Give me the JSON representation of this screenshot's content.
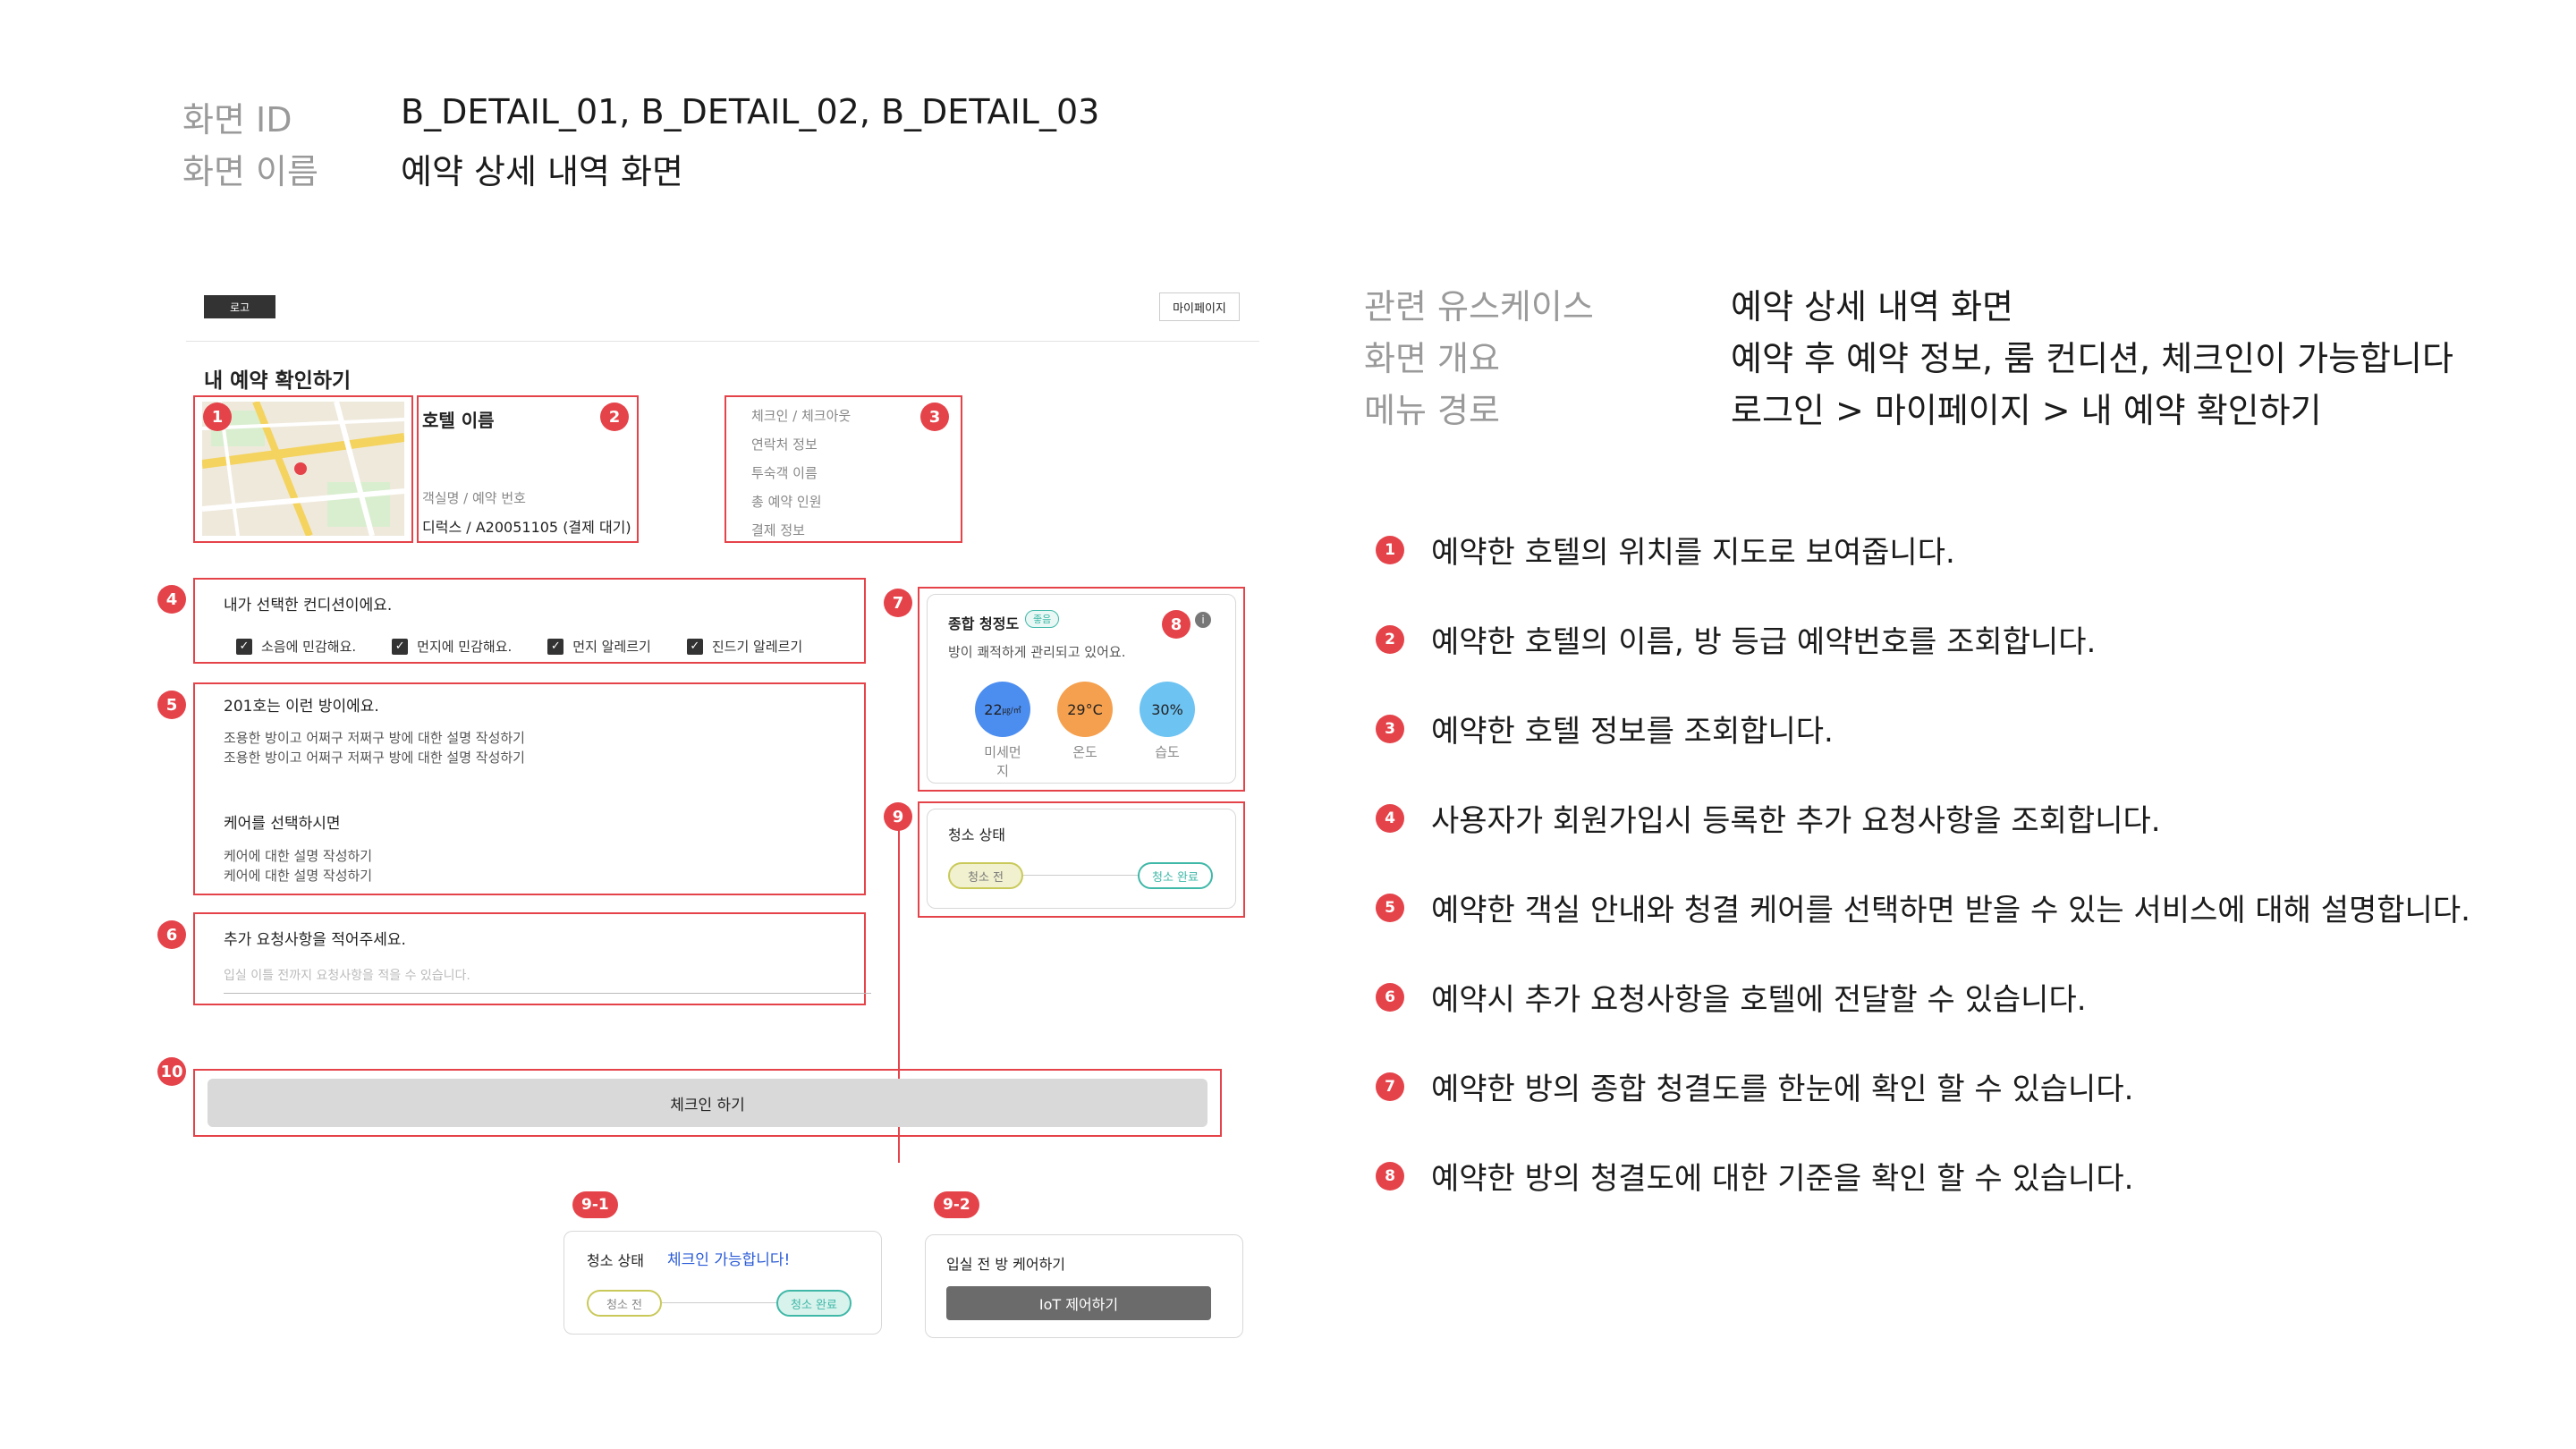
{
  "header": {
    "screen_id_label": "화면 ID",
    "screen_id_value": "B_DETAIL_01, B_DETAIL_02, B_DETAIL_03",
    "screen_name_label": "화면 이름",
    "screen_name_value": "예약 상세 내역 화면"
  },
  "meta": {
    "usecase_label": "관련 유스케이스",
    "usecase_value": "예약 상세 내역 화면",
    "overview_label": "화면 개요",
    "overview_value": "예약 후 예약 정보, 룸 컨디션, 체크인이 가능합니다",
    "menu_label": "메뉴 경로",
    "menu_value": "로그인 > 마이페이지 > 내 예약 확인하기"
  },
  "mockup": {
    "logo": "로고",
    "mypage_button": "마이페이지",
    "page_title": "내 예약 확인하기",
    "hotel_name": "호텔 이름",
    "room_label": "객실명 / 예약 번호",
    "room_value": "디럭스 / A20051105 (결제 대기)",
    "info_items": [
      "체크인 / 체크아웃",
      "연락처 정보",
      "투숙객 이름",
      "총 예약 인원",
      "결제 정보"
    ],
    "conditions_title": "내가 선택한 컨디션이에요.",
    "conditions": [
      "소음에 민감해요.",
      "먼지에 민감해요.",
      "먼지 알레르기",
      "진드기 알레르기"
    ],
    "room_title": "201호는 이런 방이에요.",
    "room_desc": [
      "조용한 방이고 어쩌구 저쩌구 방에 대한 설명 작성하기",
      "조용한 방이고 어쩌구 저쩌구 방에 대한 설명 작성하기"
    ],
    "care_title": "케어를 선택하시면",
    "care_desc": [
      "케어에 대한 설명 작성하기",
      "케어에 대한 설명 작성하기"
    ],
    "request_title": "추가 요청사항을 적어주세요.",
    "request_placeholder": "입실 이틀 전까지 요청사항을 적을 수 있습니다.",
    "clean_title": "종합 청정도",
    "clean_badge": "좋음",
    "clean_sub": "방이 쾌적하게 관리되고 있어요.",
    "metrics": [
      {
        "value": "22",
        "unit": "㎍/㎥",
        "label": "미세먼지",
        "color": "#4c8df0"
      },
      {
        "value": "29°C",
        "unit": "",
        "label": "온도",
        "color": "#f5a04e"
      },
      {
        "value": "30%",
        "unit": "",
        "label": "습도",
        "color": "#6dc3f2"
      }
    ],
    "status_title": "청소 상태",
    "status_before": "청소 전",
    "status_done": "청소 완료",
    "checkin_button": "체크인 하기",
    "card91_title": "청소 상태",
    "card91_msg": "체크인 가능합니다!",
    "card91_before": "청소 전",
    "card91_done": "청소 완료",
    "card92_title": "입실 전 방 케어하기",
    "card92_button": "IoT 제어하기"
  },
  "badges": [
    "1",
    "2",
    "3",
    "4",
    "5",
    "6",
    "7",
    "8",
    "9",
    "10",
    "9-1",
    "9-2"
  ],
  "descriptions": [
    {
      "num": "1",
      "text": "예약한 호텔의 위치를 지도로 보여줍니다."
    },
    {
      "num": "2",
      "text": "예약한 호텔의 이름, 방 등급 예약번호를 조회합니다."
    },
    {
      "num": "3",
      "text": "예약한 호텔 정보를 조회합니다."
    },
    {
      "num": "4",
      "text": "사용자가 회원가입시 등록한 추가 요청사항을 조회합니다."
    },
    {
      "num": "5",
      "text": "예약한 객실 안내와 청결 케어를 선택하면 받을 수 있는 서비스에 대해 설명합니다."
    },
    {
      "num": "6",
      "text": "예약시 추가 요청사항을 호텔에 전달할 수 있습니다."
    },
    {
      "num": "7",
      "text": "예약한 방의 종합 청결도를 한눈에 확인 할 수 있습니다."
    },
    {
      "num": "8",
      "text": "예약한 방의 청결도에 대한 기준을 확인 할 수 있습니다."
    }
  ],
  "colors": {
    "accent_red": "#e5434a",
    "teal": "#3fb8a8",
    "olive": "#c9c95a",
    "blue_text": "#2a5bd7"
  }
}
